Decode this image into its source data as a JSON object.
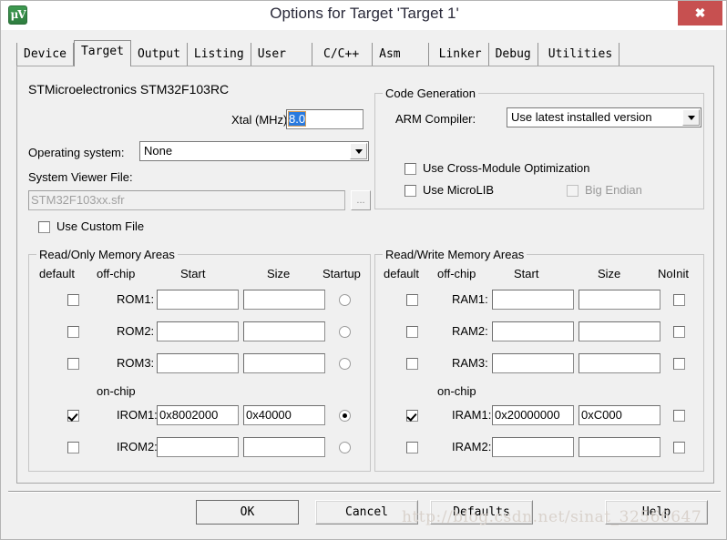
{
  "window": {
    "title": "Options for Target 'Target 1'",
    "app_icon": "uvision-icon",
    "app_icon_glyph": "μV",
    "close_label": "✖",
    "accent_close": "#c75050",
    "selection_color": "#2a7ade",
    "panel_bg": "#f0f0f0"
  },
  "tabs": [
    {
      "label": "Device",
      "active": false
    },
    {
      "label": "Target",
      "active": true
    },
    {
      "label": "Output",
      "active": false
    },
    {
      "label": "Listing",
      "active": false
    },
    {
      "label": "User",
      "active": false
    },
    {
      "label": "C/C++",
      "active": false
    },
    {
      "label": "Asm",
      "active": false
    },
    {
      "label": "Linker",
      "active": false
    },
    {
      "label": "Debug",
      "active": false
    },
    {
      "label": "Utilities",
      "active": false
    }
  ],
  "target": {
    "device_name": "STMicroelectronics STM32F103RC",
    "xtal_label": "Xtal (MHz):",
    "xtal_value": "8.0",
    "xtal_selected": true,
    "os_label": "Operating system:",
    "os_value": "None",
    "sysviewer_label": "System Viewer File:",
    "sysviewer_value": "STM32F103xx.sfr",
    "sysviewer_disabled": true,
    "browse_label": "...",
    "use_custom_file_label": "Use Custom File",
    "use_custom_file_checked": false
  },
  "code_generation": {
    "title": "Code Generation",
    "compiler_label": "ARM Compiler:",
    "compiler_value": "Use latest installed version",
    "cross_module_label": "Use Cross-Module Optimization",
    "cross_module_checked": false,
    "microlib_label": "Use MicroLIB",
    "microlib_checked": false,
    "big_endian_label": "Big Endian",
    "big_endian_checked": false,
    "big_endian_disabled": true
  },
  "rom_areas": {
    "title": "Read/Only Memory Areas",
    "headers": {
      "default": "default",
      "offchip": "off-chip",
      "start": "Start",
      "size": "Size",
      "last": "Startup"
    },
    "onchip_label": "on-chip",
    "rows": [
      {
        "name": "ROM1:",
        "checked": false,
        "start": "",
        "size": "",
        "flag": false
      },
      {
        "name": "ROM2:",
        "checked": false,
        "start": "",
        "size": "",
        "flag": false
      },
      {
        "name": "ROM3:",
        "checked": false,
        "start": "",
        "size": "",
        "flag": false
      },
      {
        "name": "IROM1:",
        "checked": true,
        "start": "0x8002000",
        "size": "0x40000",
        "flag": true
      },
      {
        "name": "IROM2:",
        "checked": false,
        "start": "",
        "size": "",
        "flag": false
      }
    ]
  },
  "ram_areas": {
    "title": "Read/Write Memory Areas",
    "headers": {
      "default": "default",
      "offchip": "off-chip",
      "start": "Start",
      "size": "Size",
      "last": "NoInit"
    },
    "onchip_label": "on-chip",
    "rows": [
      {
        "name": "RAM1:",
        "checked": false,
        "start": "",
        "size": "",
        "flag": false
      },
      {
        "name": "RAM2:",
        "checked": false,
        "start": "",
        "size": "",
        "flag": false
      },
      {
        "name": "RAM3:",
        "checked": false,
        "start": "",
        "size": "",
        "flag": false
      },
      {
        "name": "IRAM1:",
        "checked": true,
        "start": "0x20000000",
        "size": "0xC000",
        "flag": false
      },
      {
        "name": "IRAM2:",
        "checked": false,
        "start": "",
        "size": "",
        "flag": false
      }
    ]
  },
  "buttons": {
    "ok": "OK",
    "cancel": "Cancel",
    "defaults": "Defaults",
    "help": "Help"
  },
  "watermark": "http://blog.csdn.net/sinat_32566647"
}
